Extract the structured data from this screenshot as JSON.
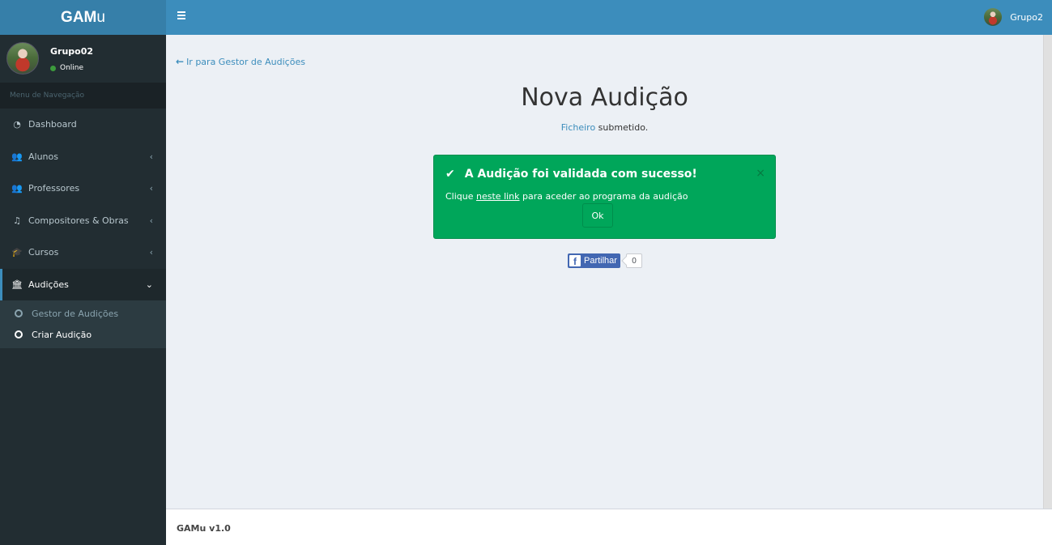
{
  "brand": {
    "bold": "GAM",
    "rest": "u"
  },
  "user": {
    "name": "Grupo02",
    "status": "Online",
    "top_name": "Grupo2"
  },
  "nav": {
    "header": "Menu de Navegação",
    "items": [
      {
        "label": "Dashboard",
        "icon": "dashboard-icon",
        "glyph": "◔",
        "chevron": ""
      },
      {
        "label": "Alunos",
        "icon": "users-icon",
        "glyph": "👥",
        "chevron": "‹"
      },
      {
        "label": "Professores",
        "icon": "users-icon",
        "glyph": "👥",
        "chevron": "‹"
      },
      {
        "label": "Compositores & Obras",
        "icon": "music-icon",
        "glyph": "♫",
        "chevron": "‹"
      },
      {
        "label": "Cursos",
        "icon": "graduation-cap-icon",
        "glyph": "🎓",
        "chevron": "‹"
      },
      {
        "label": "Audições",
        "icon": "institution-icon",
        "glyph": "🏛",
        "chevron": "⌄"
      }
    ],
    "subitems": [
      {
        "label": "Gestor de Audições"
      },
      {
        "label": "Criar Audição"
      }
    ]
  },
  "content": {
    "back_link": "Ir para Gestor de Audições",
    "title": "Nova Audição",
    "submitted_link": "Ficheiro",
    "submitted_text": " submetido.",
    "alert": {
      "title": "A Audição foi validada com sucesso!",
      "close": "×",
      "text_before": "Clique ",
      "link": "neste link",
      "text_after": " para aceder ao programa da audição",
      "ok": "Ok"
    },
    "share": {
      "label": "Partilhar",
      "count": "0"
    }
  },
  "footer": {
    "text": "GAMu v1.0"
  },
  "colors": {
    "header": "#3c8dbc",
    "logo": "#367fa9",
    "sidebar": "#222d32",
    "success": "#00a65a",
    "facebook": "#4267b2"
  }
}
